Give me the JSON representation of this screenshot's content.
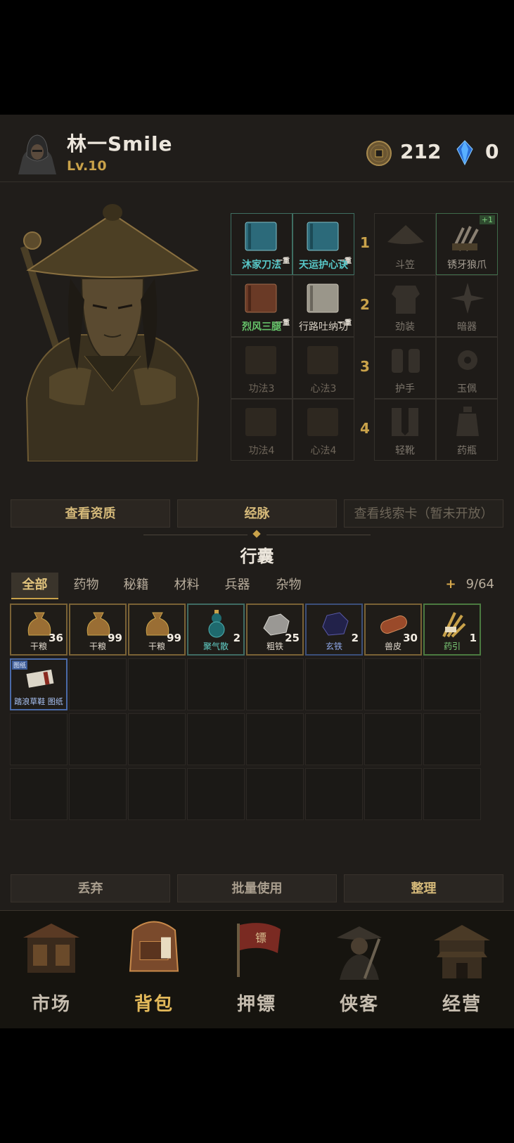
{
  "player": {
    "name": "林一Smile",
    "level": "Lv.10"
  },
  "currency": {
    "coins": "212",
    "gems": "0"
  },
  "equipment": {
    "rows": [
      "1",
      "2",
      "3",
      "4"
    ],
    "left": [
      [
        {
          "label": "沐家刀法",
          "tag": "一重",
          "style": "teal"
        },
        {
          "label": "天运护心诀",
          "tag": "一重",
          "style": "teal"
        }
      ],
      [
        {
          "label": "烈风三腿",
          "tag": "一重",
          "style": "green"
        },
        {
          "label": "行路吐纳功",
          "tag": "一重",
          "style": "white"
        }
      ],
      [
        {
          "label": "功法3",
          "tag": "",
          "style": "dim"
        },
        {
          "label": "心法3",
          "tag": "",
          "style": "dim"
        }
      ],
      [
        {
          "label": "功法4",
          "tag": "",
          "style": "dim"
        },
        {
          "label": "心法4",
          "tag": "",
          "style": "dim"
        }
      ]
    ],
    "right": [
      [
        {
          "label": "斗笠",
          "plus": ""
        },
        {
          "label": "锈牙狼爪",
          "plus": "+1"
        }
      ],
      [
        {
          "label": "劲装",
          "plus": ""
        },
        {
          "label": "暗器",
          "plus": ""
        }
      ],
      [
        {
          "label": "护手",
          "plus": ""
        },
        {
          "label": "玉佩",
          "plus": ""
        }
      ],
      [
        {
          "label": "轻靴",
          "plus": ""
        },
        {
          "label": "药瓶",
          "plus": ""
        }
      ]
    ]
  },
  "actions": {
    "aptitude": "查看资质",
    "meridian": "经脉",
    "clue_card": "查看线索卡（暂未开放）"
  },
  "bag": {
    "title": "行囊",
    "tabs": [
      "全部",
      "药物",
      "秘籍",
      "材料",
      "兵器",
      "杂物"
    ],
    "active_tab": "全部",
    "capacity": "9/64",
    "capacity_plus": "+",
    "items": [
      {
        "name": "干粮",
        "count": "36",
        "rarity": "common",
        "icon": "food-sack-icon"
      },
      {
        "name": "干粮",
        "count": "99",
        "rarity": "common",
        "icon": "food-sack-icon"
      },
      {
        "name": "干粮",
        "count": "99",
        "rarity": "common",
        "icon": "food-sack-icon"
      },
      {
        "name": "聚气散",
        "count": "2",
        "rarity": "teal",
        "icon": "potion-gourd-icon"
      },
      {
        "name": "粗铁",
        "count": "25",
        "rarity": "common",
        "icon": "iron-ore-icon"
      },
      {
        "name": "玄铁",
        "count": "2",
        "rarity": "blue",
        "icon": "dark-iron-icon"
      },
      {
        "name": "兽皮",
        "count": "30",
        "rarity": "common",
        "icon": "hide-roll-icon"
      },
      {
        "name": "药引",
        "count": "1",
        "rarity": "green",
        "icon": "herb-bundle-icon"
      },
      {
        "name": "踏浪草鞋 图纸",
        "count": "",
        "rarity": "blueprint",
        "badge": "图纸",
        "icon": "scroll-icon"
      }
    ]
  },
  "bottom_actions": {
    "discard": "丢弃",
    "batch_use": "批量使用",
    "sort": "整理"
  },
  "nav": [
    {
      "label": "市场",
      "icon": "market-stall-icon",
      "active": false
    },
    {
      "label": "背包",
      "icon": "backpack-icon",
      "active": true
    },
    {
      "label": "押镖",
      "icon": "escort-flag-icon",
      "active": false
    },
    {
      "label": "侠客",
      "icon": "swordsman-icon",
      "active": false
    },
    {
      "label": "经营",
      "icon": "building-icon",
      "active": false
    }
  ],
  "colors": {
    "accent_gold": "#c9a24a",
    "background": "#201d1a",
    "teal_rarity": "#58c8c8",
    "green_rarity": "#66c26a"
  }
}
